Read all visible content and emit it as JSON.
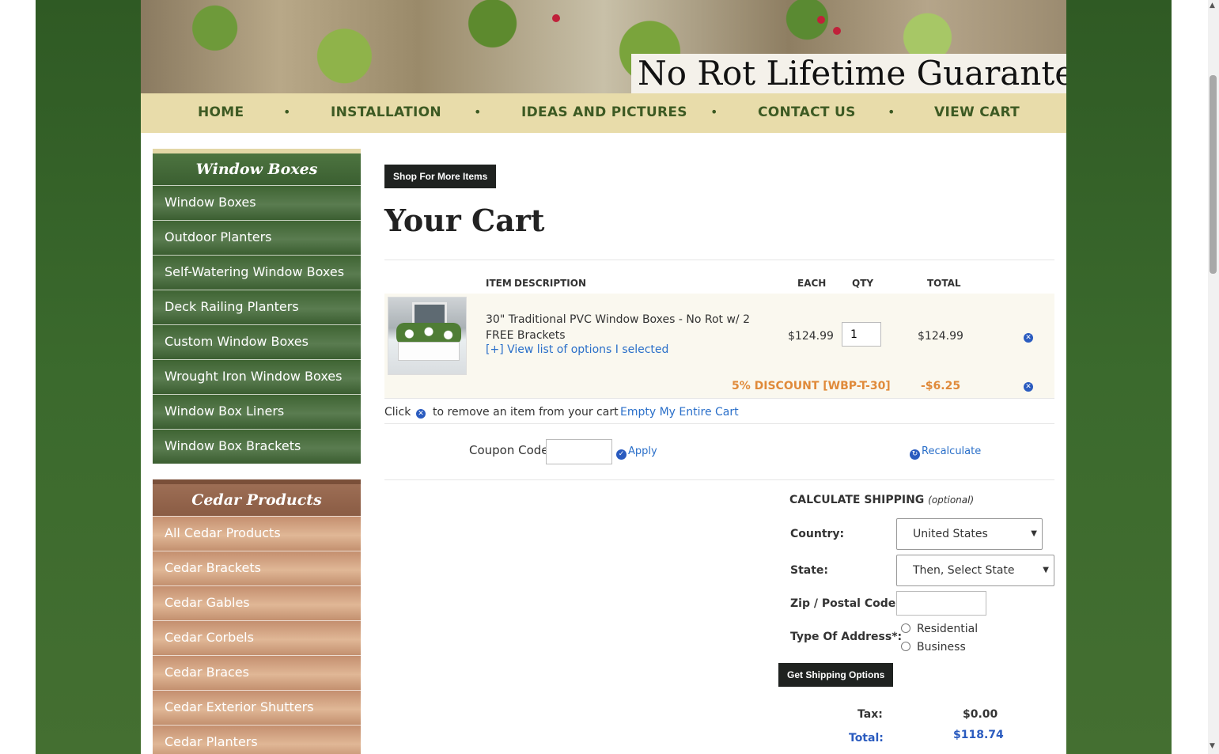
{
  "banner": {
    "tagline": "No Rot Lifetime Guaranteed!"
  },
  "topnav": {
    "items": [
      "HOME",
      "INSTALLATION",
      "IDEAS AND PICTURES",
      "CONTACT US",
      "VIEW CART"
    ],
    "separator": "•"
  },
  "sidebar": {
    "window_boxes": {
      "title": "Window Boxes",
      "items": [
        "Window Boxes",
        "Outdoor Planters",
        "Self-Watering Window Boxes",
        "Deck Railing Planters",
        "Custom Window Boxes",
        "Wrought Iron Window Boxes",
        "Window Box Liners",
        "Window Box Brackets"
      ]
    },
    "cedar": {
      "title": "Cedar Products",
      "items": [
        "All Cedar Products",
        "Cedar Brackets",
        "Cedar Gables",
        "Cedar Corbels",
        "Cedar Braces",
        "Cedar Exterior Shutters",
        "Cedar Planters"
      ]
    }
  },
  "cart": {
    "shop_more_label": "Shop For More Items",
    "title": "Your Cart",
    "headers": {
      "item": "ITEM",
      "description": "DESCRIPTION",
      "each": "EACH",
      "qty": "QTY",
      "total": "TOTAL"
    },
    "item": {
      "description": "30\" Traditional PVC Window Boxes - No Rot w/ 2 FREE Brackets",
      "options_link": "[+] View list of options I selected",
      "each": "$124.99",
      "qty": "1",
      "total": "$124.99"
    },
    "discount": {
      "label": "5% DISCOUNT [WBP-T-30]",
      "amount": "-$6.25"
    },
    "remove_note_prefix": "Click",
    "remove_note_suffix": "to remove an item from your cart",
    "empty_cart_label": "Empty My Entire Cart",
    "coupon_label": "Coupon Code:",
    "apply_label": "Apply",
    "recalc_label": "Recalculate"
  },
  "shipping": {
    "title": "CALCULATE SHIPPING",
    "title_note": "(optional)",
    "country_label": "Country:",
    "country_value": "United States",
    "state_label": "State:",
    "state_value": "Then, Select State",
    "zip_label": "Zip / Postal Code:",
    "address_type_label": "Type Of Address*:",
    "address_options": [
      "Residential",
      "Business"
    ],
    "get_options_label": "Get Shipping Options",
    "tax_label": "Tax:",
    "tax_value": "$0.00",
    "total_label": "Total:",
    "total_value": "$118.74"
  },
  "colors": {
    "nav_bg": "#e8dcaa",
    "nav_text": "#3d5a23",
    "green_side": "#3f6433",
    "cedar_side": "#c48f6f",
    "link_blue": "#2a6fc9",
    "discount_orange": "#e08a3a"
  }
}
